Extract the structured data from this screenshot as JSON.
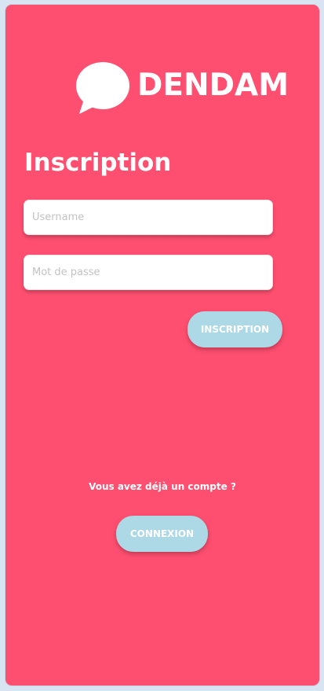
{
  "app": {
    "brand_name": "DENDAM",
    "logo_icon": "speech-bubble-icon"
  },
  "form": {
    "title": "Inscription",
    "username": {
      "placeholder": "Username",
      "value": ""
    },
    "password": {
      "placeholder": "Mot de passe",
      "value": ""
    },
    "submit_label": "INSCRIPTION"
  },
  "footer": {
    "prompt": "Vous avez déjà un compte ?",
    "login_label": "CONNEXION"
  },
  "colors": {
    "background": "#ff4f70",
    "button": "#add8e6",
    "text": "#ffffff"
  }
}
